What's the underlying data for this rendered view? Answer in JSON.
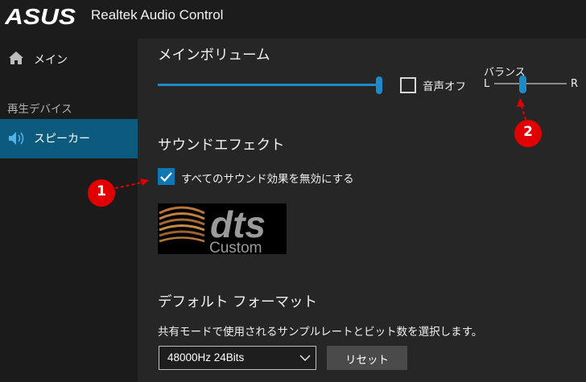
{
  "titlebar": {
    "logo_text": "ASUS",
    "app_title": "Realtek Audio Control"
  },
  "sidebar": {
    "home_label": "メイン",
    "devices_heading": "再生デバイス",
    "speaker_label": "スピーカー"
  },
  "volume": {
    "title": "メインボリューム",
    "level": 1.0,
    "mute_label": "音声オフ",
    "mute_checked": false,
    "balance_label": "バランス",
    "balance_left": "L",
    "balance_right": "R",
    "balance_position": 0.38
  },
  "effects": {
    "title": "サウンドエフェクト",
    "disable_all_label": "すべてのサウンド効果を無効にする",
    "disable_all_checked": true,
    "logo_text": "dts",
    "logo_subtext": "Custom"
  },
  "format": {
    "title": "デフォルト フォーマット",
    "description": "共有モードで使用されるサンプルレートとビット数を選択します。",
    "selected": "48000Hz 24Bits",
    "reset_label": "リセット"
  },
  "annotations": {
    "marker_1": "1",
    "marker_2": "2"
  },
  "colors": {
    "accent": "#1d8bc9",
    "selected_nav": "#0d5a7f",
    "annotation": "#e00000"
  }
}
